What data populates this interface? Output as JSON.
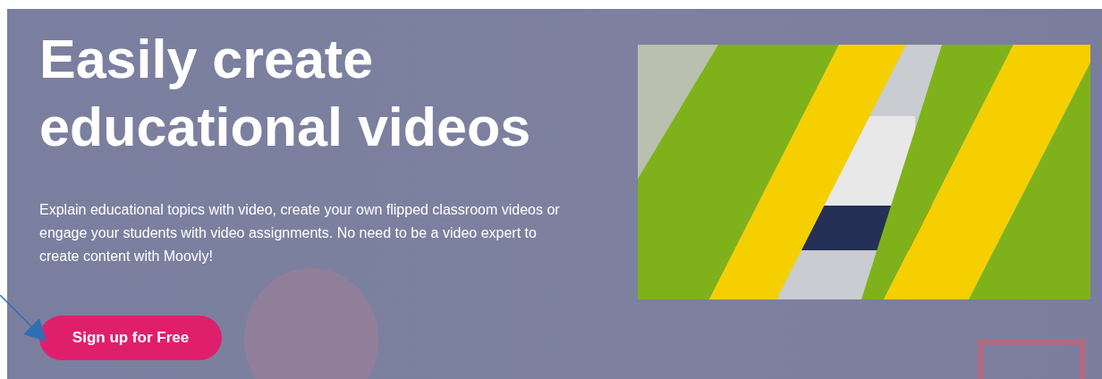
{
  "hero": {
    "title": "Easily create educational videos",
    "description": "Explain educational topics with video, create your own flipped classroom videos or engage your students with video assignments. No need to be a video expert to create content with Moovly!",
    "cta": {
      "label": "Sign up for Free"
    }
  }
}
